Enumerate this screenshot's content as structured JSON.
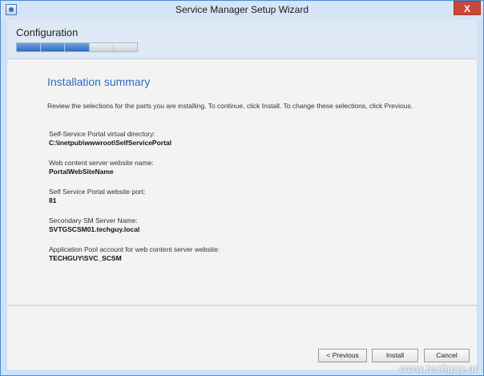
{
  "window": {
    "title": "Service Manager Setup Wizard",
    "close_label": "X"
  },
  "header": {
    "title": "Configuration",
    "progress": {
      "total_steps": 5,
      "completed_steps": 3
    }
  },
  "summary": {
    "title": "Installation summary",
    "intro": "Review the selections for the parts you are installing. To continue, click Install. To change these selections, click Previous.",
    "items": [
      {
        "label": "Self-Service Portal virtual directory:",
        "value": "C:\\inetpub\\wwwroot\\SelfServicePortal"
      },
      {
        "label": "Web content server website name:",
        "value": "PortalWebSiteName"
      },
      {
        "label": "Self Service Portal website port:",
        "value": "81"
      },
      {
        "label": "Secondary SM Server Name:",
        "value": "SVTGSCSM01.techguy.local"
      },
      {
        "label": "Application Pool account for web content server website:",
        "value": "TECHGUY\\SVC_SCSM"
      }
    ]
  },
  "buttons": {
    "previous": "< Previous",
    "install": "Install",
    "cancel": "Cancel"
  },
  "watermark": "www.techguy.at",
  "colors": {
    "accent": "#2a6fc0",
    "close": "#c9483c",
    "frame": "#4a8ad3"
  }
}
